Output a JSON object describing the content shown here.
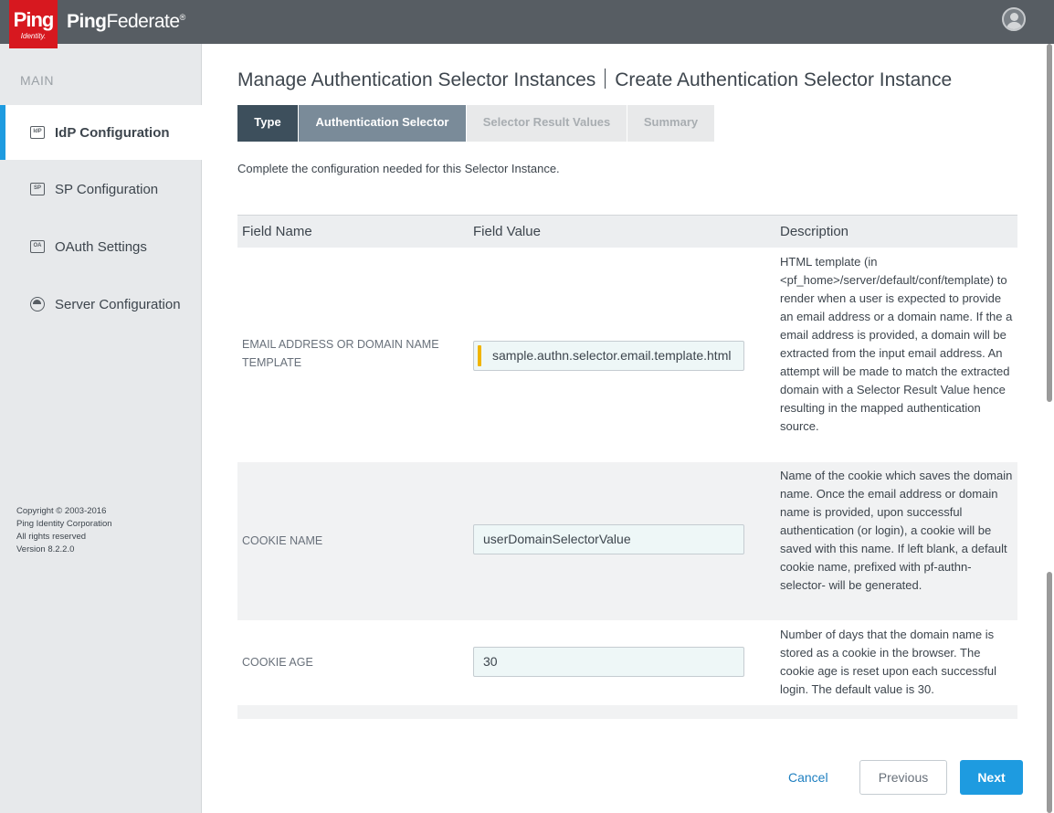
{
  "brand": {
    "logo_text": "Ping",
    "logo_sub": "Identity.",
    "product_bold": "Ping",
    "product_light": "Federate",
    "trademark": "®",
    "logo_color": "#d7181f"
  },
  "header": {
    "user_icon": "user-avatar-icon"
  },
  "sidebar": {
    "section": "MAIN",
    "items": [
      {
        "icon": "IdP",
        "label": "IdP Configuration",
        "active": true
      },
      {
        "icon": "SP",
        "label": "SP Configuration",
        "active": false
      },
      {
        "icon": "OA",
        "label": "OAuth Settings",
        "active": false
      },
      {
        "icon": "server-icon",
        "label": "Server Configuration",
        "active": false
      }
    ],
    "copyright": [
      "Copyright © 2003-2016",
      "Ping Identity Corporation",
      "All rights reserved",
      "Version 8.2.2.0"
    ]
  },
  "page": {
    "title_left": "Manage Authentication Selector Instances",
    "title_right": "Create Authentication Selector Instance",
    "intro": "Complete the configuration needed for this Selector Instance."
  },
  "wizard": {
    "steps": [
      "Type",
      "Authentication Selector",
      "Selector Result Values",
      "Summary"
    ],
    "current_index": 1
  },
  "table": {
    "headers": [
      "Field Name",
      "Field Value",
      "Description"
    ],
    "rows": [
      {
        "name": "EMAIL ADDRESS OR DOMAIN NAME TEMPLATE",
        "value": "sample.authn.selector.email.template.html",
        "required": true,
        "description": "HTML template (in <pf_home>/server/default/conf/template) to render when a user is expected to provide an email address or a domain name. If the a email address is provided, a domain will be extracted from the input email address. An attempt will be made to match the extracted domain with a Selector Result Value hence resulting in the mapped authentication source."
      },
      {
        "name": "COOKIE NAME",
        "value": "userDomainSelectorValue",
        "required": false,
        "description": "Name of the cookie which saves the domain name. Once the email address or domain name is provided, upon successful authentication (or login), a cookie will be saved with this name. If left blank, a default cookie name, prefixed with pf-authn-selector- will be generated."
      },
      {
        "name": "COOKIE AGE",
        "value": "30",
        "required": false,
        "description": "Number of days that the domain name is stored as a cookie in the browser. The cookie age is reset upon each successful login. The default value is 30."
      }
    ]
  },
  "buttons": {
    "cancel": "Cancel",
    "previous": "Previous",
    "next": "Next"
  },
  "colors": {
    "header_bg": "#575d63",
    "accent": "#1e9be0",
    "required_marker": "#f0b400",
    "step_done": "#3d4f5c",
    "step_current": "#7a8b99"
  }
}
